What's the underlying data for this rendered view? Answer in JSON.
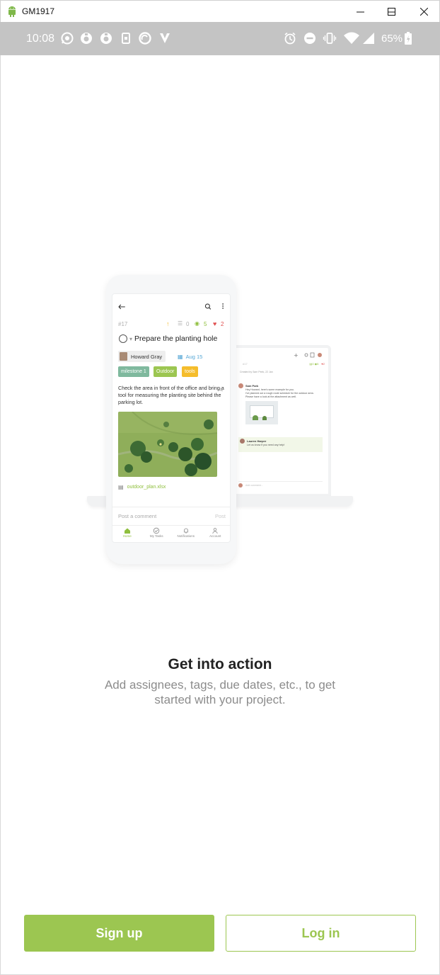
{
  "window": {
    "title": "GM1917",
    "controls": [
      "minimize",
      "maximize",
      "close"
    ]
  },
  "status_bar": {
    "time": "10:08",
    "battery_percent": "65%",
    "left_icons": [
      "whatsapp-icon",
      "app-icon",
      "app-icon",
      "sim-icon",
      "refresh-icon",
      "v-icon"
    ],
    "right_icons": [
      "alarm-icon",
      "dnd-icon",
      "vibrate-icon",
      "wifi-icon",
      "signal-icon",
      "battery-icon"
    ]
  },
  "illustration": {
    "phone": {
      "task_id": "#17",
      "priority_icon": "arrow-up-icon",
      "subtasks_count": "0",
      "watchers_count": "5",
      "likes_count": "2",
      "task_title": "Prepare the planting hole",
      "assignee": "Howard Gray",
      "due_date": "Aug 15",
      "tags": [
        {
          "label": "milestone 1",
          "color": "#7fb99e"
        },
        {
          "label": "Outdoor",
          "color": "#9cc651"
        },
        {
          "label": "tools",
          "color": "#f5bd2c"
        }
      ],
      "description": "Check the area in front of the office and bring a tool for measuring the planting site behind the parking lot.",
      "attachment": "outdoor_plan.xlsx",
      "comment_placeholder": "Post a comment",
      "comment_post": "Post",
      "nav": [
        {
          "label": "Home",
          "icon": "home-icon",
          "active": true
        },
        {
          "label": "My Tasks",
          "icon": "check-circle-icon",
          "active": false
        },
        {
          "label": "Notifications",
          "icon": "bell-icon",
          "active": false
        },
        {
          "label": "Account",
          "icon": "person-icon",
          "active": false
        }
      ]
    },
    "laptop": {
      "task_id": "#17",
      "created_by": "Created by Sam Peek, 22 Jan",
      "comments": [
        {
          "author": "Sam Park",
          "lines": [
            "Hey Howard, here's some example for you.",
            "I've planned out a rough route schedule for the outdoor area.",
            "Please have a look at the attachment as well."
          ]
        },
        {
          "author": "Lauren Harper",
          "lines": [
            "Let us know if you need any help!"
          ]
        }
      ],
      "comment_placeholder": "Add comment..."
    }
  },
  "onboarding": {
    "headline": "Get into action",
    "subline": "Add assignees, tags, due dates, etc., to get started with your project."
  },
  "buttons": {
    "signup": "Sign up",
    "login": "Log in"
  },
  "colors": {
    "accent": "#9cc651",
    "status_bar": "#c4c4c4",
    "subtext": "#8c8c8c"
  }
}
